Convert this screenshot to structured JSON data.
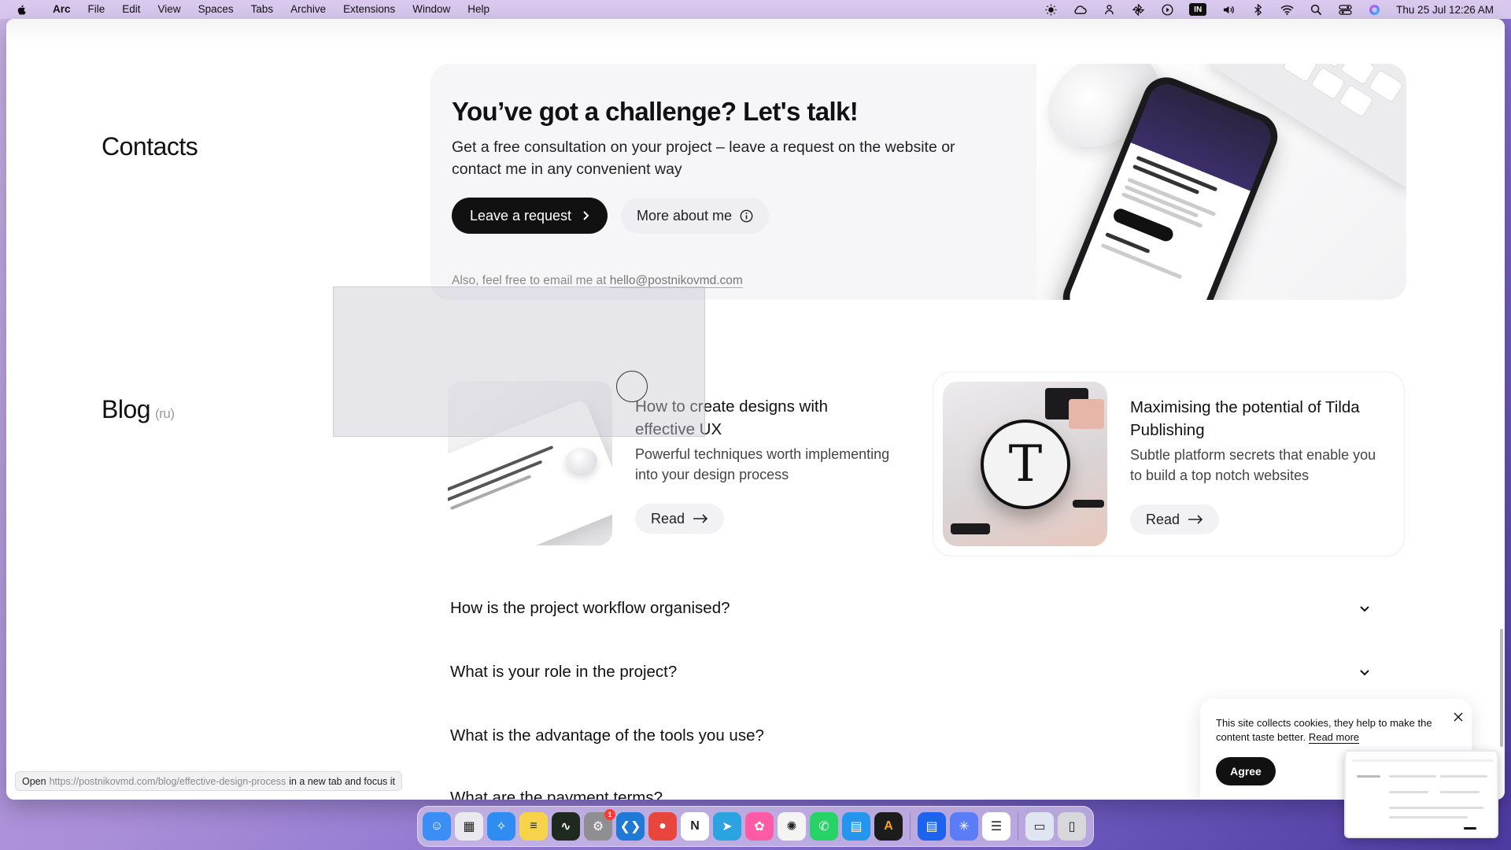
{
  "menubar": {
    "apple_icon": "apple-logo-icon",
    "app_name": "Arc",
    "menus": [
      "File",
      "Edit",
      "View",
      "Spaces",
      "Tabs",
      "Archive",
      "Extensions",
      "Window",
      "Help"
    ],
    "status_icons": [
      "brightness-icon",
      "cloud-icon",
      "person-icon",
      "pinwheel-icon",
      "play-icon",
      "keyboard-layout-icon",
      "volume-icon",
      "bluetooth-icon",
      "wifi-icon",
      "search-icon",
      "control-center-icon",
      "siri-icon"
    ],
    "keyboard_layout": "IN",
    "clock": "Thu 25 Jul  12:26 AM"
  },
  "contacts": {
    "section_title": "Contacts",
    "heading": "You’ve got a challenge? Let's talk!",
    "lead": "Get a free consultation on your project – leave a request on the website or contact me in any convenient way",
    "primary_button": "Leave a request",
    "secondary_button": "More about me",
    "email_prefix": "Also, feel free to email me at",
    "email": "hello@postnikovmd.com"
  },
  "blog": {
    "section_title": "Blog",
    "section_sub": "(ru)",
    "posts": [
      {
        "title": "How to create designs with effective UX",
        "description": "Powerful techniques worth implementing into your design process",
        "read_label": "Read"
      },
      {
        "title": "Maximising the potential of Tilda Publishing",
        "description": "Subtle platform secrets that enable you to build a top notch websites",
        "read_label": "Read"
      }
    ]
  },
  "faq": [
    "How is the project workflow organised?",
    "What is your role in the project?",
    "What is the advantage of the tools you use?",
    "What are the payment terms?"
  ],
  "status_tip": {
    "prefix": "Open",
    "url": "https://postnikovmd.com/blog/effective-design-process",
    "suffix": "in a new tab and focus it"
  },
  "cookie": {
    "text": "This site collects cookies, they help to make the content taste better.",
    "read_more": "Read more",
    "agree": "Agree"
  },
  "dock": {
    "apps": [
      {
        "name": "Finder",
        "icon": "finder-icon",
        "color": "#3a8ef6"
      },
      {
        "name": "Launchpad",
        "icon": "launchpad-icon",
        "color": "#e9e9ef"
      },
      {
        "name": "Safari",
        "icon": "safari-icon",
        "color": "#2f8cf0"
      },
      {
        "name": "Notes",
        "icon": "notes-icon",
        "color": "#f7d34a"
      },
      {
        "name": "Activity Monitor",
        "icon": "activity-monitor-icon",
        "color": "#1f2a1f"
      },
      {
        "name": "System Settings",
        "icon": "settings-icon",
        "color": "#8e8e93",
        "badge": "1"
      },
      {
        "name": "VS Code",
        "icon": "vscode-icon",
        "color": "#1f7ad6"
      },
      {
        "name": "Chrome",
        "icon": "chrome-icon",
        "color": "#e8453c"
      },
      {
        "name": "Notion",
        "icon": "notion-icon",
        "color": "#ffffff"
      },
      {
        "name": "Telegram",
        "icon": "telegram-icon",
        "color": "#2aa3e0"
      },
      {
        "name": "Pinwheel",
        "icon": "pinwheel-app-icon",
        "color": "#ff5aa5"
      },
      {
        "name": "ChatGPT",
        "icon": "chatgpt-icon",
        "color": "#f4f4f4"
      },
      {
        "name": "WhatsApp",
        "icon": "whatsapp-icon",
        "color": "#25d366"
      },
      {
        "name": "Docker",
        "icon": "docker-icon",
        "color": "#2496ed"
      },
      {
        "name": "Affinity",
        "icon": "affinity-icon",
        "color": "#1c1c1c"
      },
      {
        "name": "Docker Desktop",
        "icon": "docker-desktop-icon",
        "color": "#1d63ed"
      },
      {
        "name": "Perplexity",
        "icon": "perplexity-icon",
        "color": "#5b7cf7"
      },
      {
        "name": "Reminders",
        "icon": "reminders-icon",
        "color": "#ffffff"
      },
      {
        "name": "Downloads",
        "icon": "downloads-folder-icon",
        "color": "#dfe6f2"
      },
      {
        "name": "Trash",
        "icon": "trash-icon",
        "color": "#d7d7dc"
      }
    ]
  },
  "colors": {
    "accent_dark": "#111111",
    "card_bg": "#f6f5f8",
    "menubar_bg": "#d9c9ef"
  }
}
